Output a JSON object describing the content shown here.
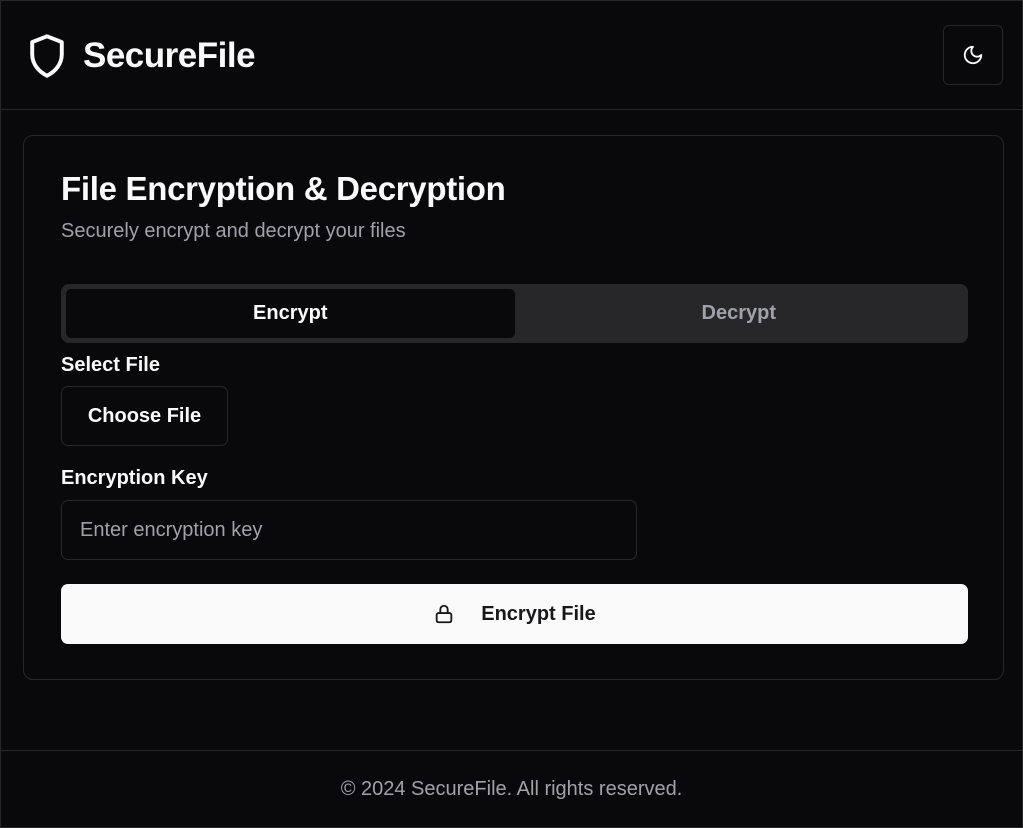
{
  "header": {
    "brand_icon": "shield-icon",
    "brand_name": "SecureFile",
    "theme_toggle_icon": "moon-icon"
  },
  "card": {
    "title": "File Encryption & Decryption",
    "subtitle": "Securely encrypt and decrypt your files",
    "tabs": [
      {
        "label": "Encrypt",
        "active": true
      },
      {
        "label": "Decrypt",
        "active": false
      }
    ],
    "file": {
      "label": "Select File",
      "button_label": "Choose File"
    },
    "key": {
      "label": "Encryption Key",
      "placeholder": "Enter encryption key",
      "value": ""
    },
    "submit": {
      "icon": "lock-icon",
      "label": "Encrypt File"
    }
  },
  "footer": {
    "text": "© 2024 SecureFile. All rights reserved."
  },
  "colors": {
    "background": "#09090b",
    "border": "#27272a",
    "muted_text": "#a1a1aa",
    "foreground": "#fafafa",
    "primary_button": "#fafafa",
    "primary_button_text": "#18181b"
  }
}
